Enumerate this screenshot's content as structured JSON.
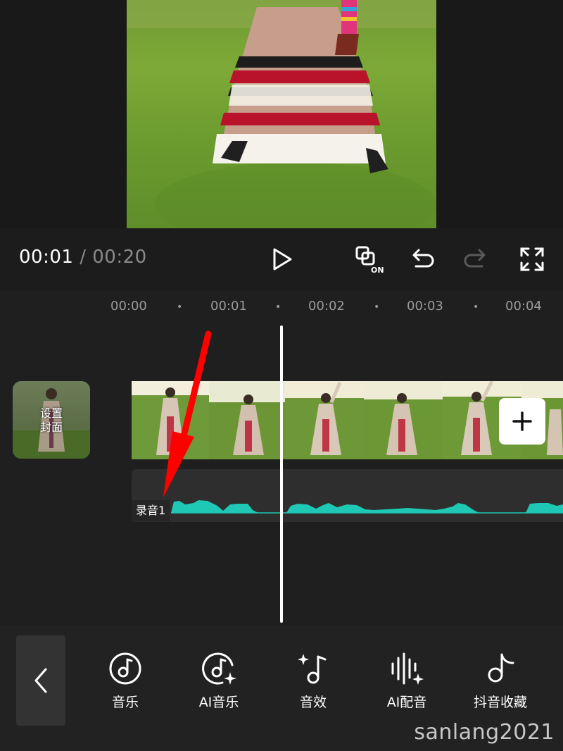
{
  "player": {
    "current_time": "00:01",
    "separator": " / ",
    "total_time": "00:20"
  },
  "controls": {
    "play_icon": "play-icon",
    "sync_icon": "sync-on-icon",
    "sync_badge": "ON",
    "undo_icon": "undo-icon",
    "redo_icon": "redo-icon",
    "fullscreen_icon": "fullscreen-icon"
  },
  "ruler": {
    "ticks": [
      "00:00",
      "00:01",
      "00:02",
      "00:03",
      "00:04"
    ]
  },
  "timeline": {
    "cover_line1": "设置",
    "cover_line2": "封面",
    "audio_label": "录音1"
  },
  "toolbar": {
    "items": [
      {
        "label": "音乐",
        "icon": "music-disc-icon"
      },
      {
        "label": "AI音乐",
        "icon": "ai-music-icon"
      },
      {
        "label": "音效",
        "icon": "sound-effect-icon"
      },
      {
        "label": "AI配音",
        "icon": "ai-voiceover-icon"
      },
      {
        "label": "抖音收藏",
        "icon": "douyin-favorites-icon"
      }
    ]
  },
  "watermark": "sanlang2021",
  "colors": {
    "waveform": "#1ec8b4",
    "annotation_arrow": "#ff0000",
    "background": "#1a1a1a"
  }
}
